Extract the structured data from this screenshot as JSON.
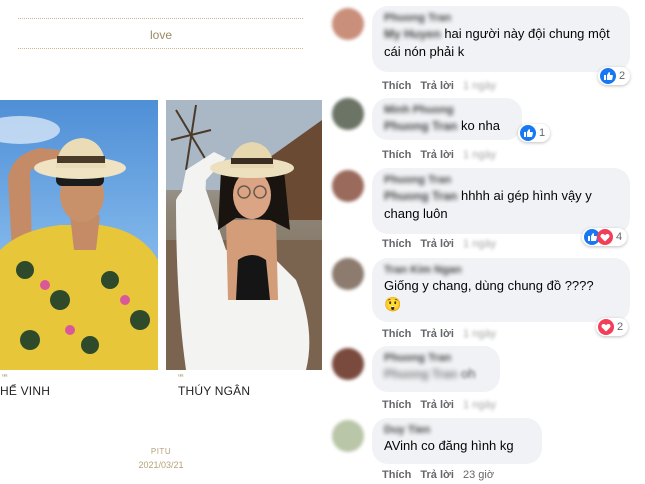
{
  "collage": {
    "heading": "love",
    "quote_mark": "““",
    "left_caption": "HỂ VINH",
    "right_caption": "THÚY NGÂN",
    "footer_brand": "PITU",
    "footer_date": "2021/03/21"
  },
  "comments": [
    {
      "author": "Phuong Tran",
      "mention": "My Huyen",
      "text": "hai người này đội chung một cái nón phải k",
      "like": "Thích",
      "reply": "Trả lời",
      "time": "1 ngày",
      "reaction_count": "2",
      "reactions": [
        "like"
      ],
      "avatar_color": "#c98f7a"
    },
    {
      "author": "Minh Phuong",
      "mention": "Phuong Tran",
      "text": "ko nha",
      "like": "Thích",
      "reply": "Trả lời",
      "time": "1 ngày",
      "reaction_count": "1",
      "reactions": [
        "like"
      ],
      "avatar_color": "#6c7466"
    },
    {
      "author": "Phuong Tran",
      "mention": "Phuong Tran",
      "text": "hhhh ai gép hình vậy y chang luôn",
      "like": "Thích",
      "reply": "Trả lời",
      "time": "1 ngày",
      "reaction_count": "4",
      "reactions": [
        "like",
        "heart"
      ],
      "avatar_color": "#9a6a5c"
    },
    {
      "author": "Tran Kim Ngan",
      "mention": "",
      "text": "Giống y chang, dùng chung đồ ????",
      "emoji": "😲",
      "like": "Thích",
      "reply": "Trả lời",
      "time": "1 ngày",
      "reaction_count": "2",
      "reactions": [
        "heart"
      ],
      "avatar_color": "#8c7b6e"
    },
    {
      "author": "Phuong Tran",
      "mention": "Phuong Tran",
      "text": "oh",
      "like": "Thích",
      "reply": "Trả lời",
      "time": "1 ngày",
      "avatar_color": "#7a4a3e"
    },
    {
      "author": "Duy Tien",
      "mention": "",
      "text": "AVinh co đăng hình kg",
      "like": "Thích",
      "reply": "Trả lời",
      "time": "23 giờ",
      "avatar_color": "#b9c6a8"
    }
  ],
  "colors": {
    "like_blue": "#1877f2",
    "heart_red": "#f33e58",
    "bubble_bg": "#f0f2f5",
    "accent_gold": "#b5a27a"
  }
}
